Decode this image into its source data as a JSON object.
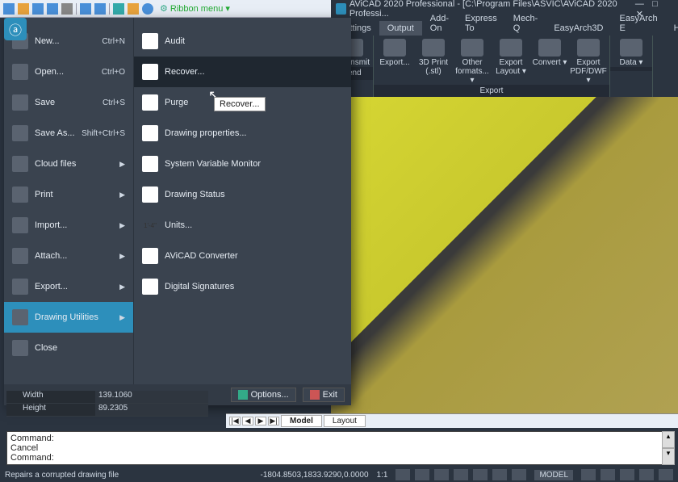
{
  "qat": {
    "ribbon_menu_label": "Ribbon menu"
  },
  "titlebar": {
    "text": "AViCAD 2020 Professional - [C:\\Program Files\\ASVIC\\AViCAD 2020 Professi...",
    "logo_hint": "AViCAD"
  },
  "ribbon_tabs": [
    "Settings",
    "Output",
    "Add-On",
    "Express To",
    "Mech-Q",
    "EasyArch3D",
    "EasyArch E",
    "Help"
  ],
  "ribbon_active_tab": "Output",
  "ribbon": {
    "groups": [
      {
        "label": "Send",
        "buttons": [
          "eTransmit"
        ]
      },
      {
        "label": "Export",
        "buttons": [
          "Export...",
          "3D Print (.stl)",
          "Other formats... ▾",
          "Export Layout ▾",
          "Convert ▾",
          "Export PDF/DWF ▾"
        ]
      },
      {
        "label": "",
        "buttons": [
          "Data ▾"
        ]
      }
    ]
  },
  "app_menu": {
    "left": [
      {
        "label": "New...",
        "shortcut": "Ctrl+N",
        "submenu": false
      },
      {
        "label": "Open...",
        "shortcut": "Ctrl+O",
        "submenu": false
      },
      {
        "label": "Save",
        "shortcut": "Ctrl+S",
        "submenu": false
      },
      {
        "label": "Save As...",
        "shortcut": "Shift+Ctrl+S",
        "submenu": false
      },
      {
        "label": "Cloud files",
        "submenu": true
      },
      {
        "label": "Print",
        "submenu": true
      },
      {
        "label": "Import...",
        "submenu": true
      },
      {
        "label": "Attach...",
        "submenu": true
      },
      {
        "label": "Export...",
        "submenu": true
      },
      {
        "label": "Drawing Utilities",
        "submenu": true,
        "active": true
      },
      {
        "label": "Close"
      }
    ],
    "right": [
      {
        "label": "Audit"
      },
      {
        "label": "Recover...",
        "hover": true
      },
      {
        "label": "Purge"
      },
      {
        "label": "Drawing properties..."
      },
      {
        "label": "System Variable Monitor"
      },
      {
        "label": "Drawing Status"
      },
      {
        "label": "Units...",
        "icon_text": "1'-4\""
      },
      {
        "label": "AViCAD Converter"
      },
      {
        "label": "Digital Signatures"
      }
    ],
    "footer": {
      "options": "Options...",
      "exit": "Exit"
    }
  },
  "tooltip": "Recover...",
  "properties": {
    "rows": [
      {
        "label": "Width",
        "value": "139.1060"
      },
      {
        "label": "Height",
        "value": "89.2305"
      }
    ]
  },
  "model_tabs": {
    "nav": [
      "|◀",
      "◀",
      "▶",
      "▶|"
    ],
    "tabs": [
      "Model",
      "Layout"
    ]
  },
  "command_lines": [
    "Command:",
    "Cancel",
    "Command:"
  ],
  "status": {
    "hint": "Repairs a corrupted drawing file",
    "coords": "-1804.8503,1833.9290,0.0000",
    "scale": "1:1",
    "model_label": "MODEL"
  }
}
